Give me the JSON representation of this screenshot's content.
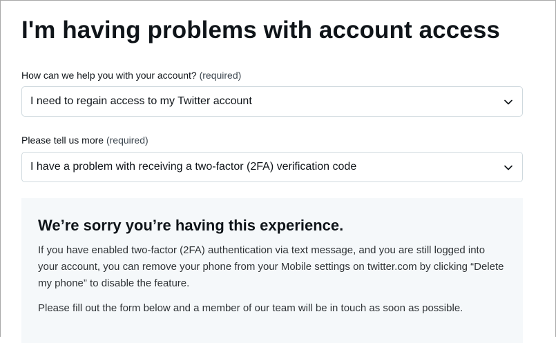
{
  "page": {
    "title": "I'm having problems with account access"
  },
  "form": {
    "question1": {
      "label": "How can we help you with your account?",
      "required": "(required)",
      "value": "I need to regain access to my Twitter account"
    },
    "question2": {
      "label": "Please tell us more",
      "required": "(required)",
      "value": "I have a problem with receiving a two-factor (2FA) verification code"
    }
  },
  "info": {
    "title": "We’re sorry you’re having this experience.",
    "paragraph1": "If you have enabled two-factor (2FA) authentication via text message, and you are still logged into your account, you can remove your phone from your Mobile settings on twitter.com by clicking “Delete my phone” to disable the feature.",
    "paragraph2": "Please fill out the form below and a member of our team will be in touch as soon as possible."
  },
  "icons": {
    "select_chevron": "chevron-down-icon"
  },
  "colors": {
    "text": "#0f1419",
    "border": "#cfd9de",
    "panel_bg": "#f5f8fa"
  }
}
